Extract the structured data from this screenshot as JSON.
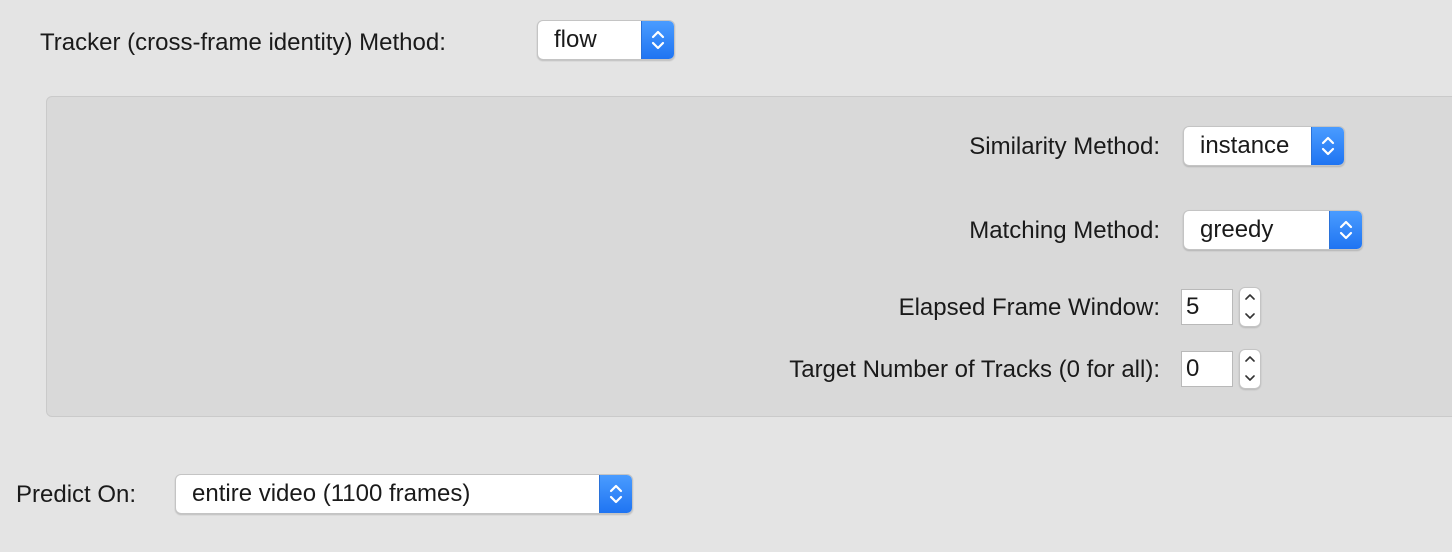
{
  "tracker": {
    "label": "Tracker (cross-frame identity) Method:",
    "value": "flow"
  },
  "panel": {
    "similarity": {
      "label": "Similarity Method:",
      "value": "instance"
    },
    "matching": {
      "label": "Matching Method:",
      "value": "greedy"
    },
    "elapsed": {
      "label": "Elapsed Frame Window:",
      "value": "5"
    },
    "target": {
      "label": "Target Number of Tracks (0 for all):",
      "value": "0"
    }
  },
  "predict": {
    "label": "Predict On:",
    "value": "entire video (1100 frames)"
  },
  "colors": {
    "accent": "#1f74f2",
    "window_bg": "#e4e4e4",
    "panel_bg": "#d9d9d9"
  },
  "icons": {
    "popup": "chevron-up-down-icon",
    "stepper_up": "chevron-up-icon",
    "stepper_down": "chevron-down-icon"
  }
}
